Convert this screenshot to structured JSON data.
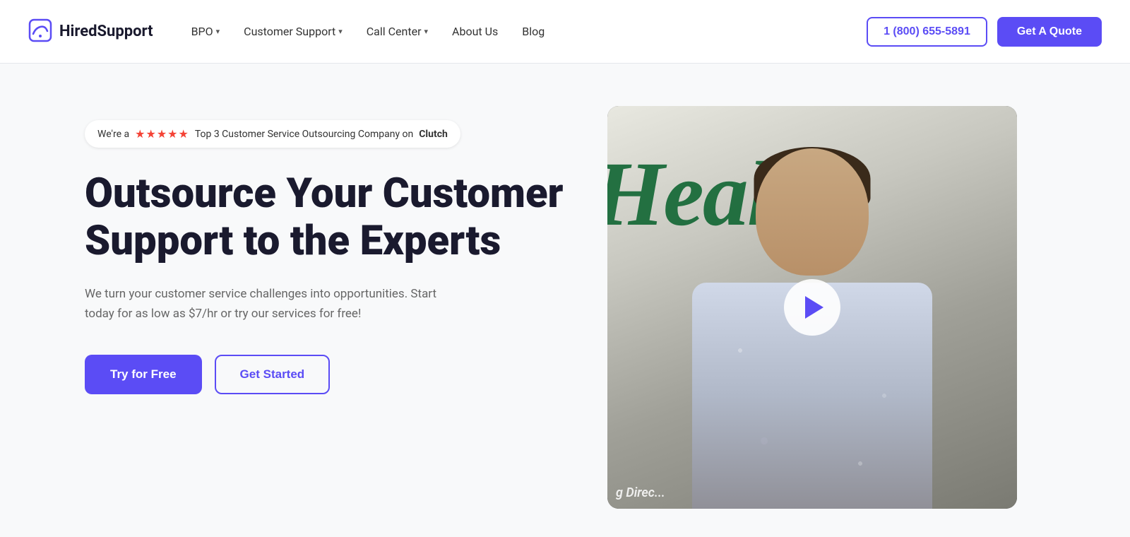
{
  "navbar": {
    "logo_text": "HiredSupport",
    "nav_items": [
      {
        "label": "BPO",
        "has_dropdown": true
      },
      {
        "label": "Customer Support",
        "has_dropdown": true
      },
      {
        "label": "Call Center",
        "has_dropdown": true
      },
      {
        "label": "About Us",
        "has_dropdown": false
      },
      {
        "label": "Blog",
        "has_dropdown": false
      }
    ],
    "phone": "1 (800) 655-5891",
    "quote_label": "Get A Quote"
  },
  "hero": {
    "badge_text_pre": "We're a",
    "badge_stars": "★★★★★",
    "badge_text_post": "Top 3 Customer Service Outsourcing Company on",
    "badge_bold": "Clutch",
    "title": "Outsource Your Customer Support to the Experts",
    "description": "We turn your customer service challenges into opportunities. Start today for as low as $7/hr or try our services for free!",
    "try_free_label": "Try for Free",
    "get_started_label": "Get Started",
    "video_bottom_text": "g Direc..."
  }
}
